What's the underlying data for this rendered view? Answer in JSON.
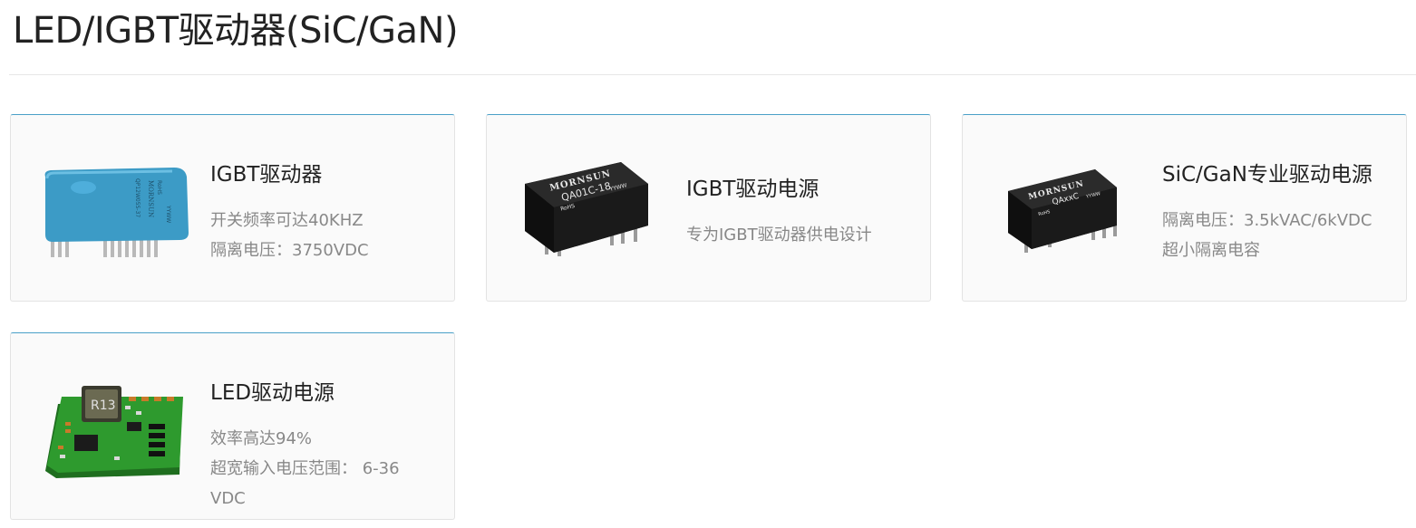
{
  "page": {
    "title": "LED/IGBT驱动器(SiC/GaN)"
  },
  "products": [
    {
      "name": "IGBT驱动器",
      "features": [
        "开关频率可达40KHZ",
        "隔离电压：3750VDC"
      ],
      "image": {
        "kind": "blue-module",
        "brand": "MORNSUN",
        "marks": [
          "QP12W05S-37",
          "RoHS",
          "YYWW"
        ],
        "color": "#3c9bc6"
      }
    },
    {
      "name": "IGBT驱动电源",
      "features": [
        "专为IGBT驱动器供电设计"
      ],
      "image": {
        "kind": "black-module",
        "brand": "MORNSUN",
        "marks": [
          "QA01C-18",
          "RoHS",
          "YYWW"
        ],
        "color": "#1e1e1e"
      }
    },
    {
      "name": "SiC/GaN专业驱动电源",
      "features": [
        "隔离电压：3.5kVAC/6kVDC",
        "超小隔离电容"
      ],
      "image": {
        "kind": "black-module",
        "brand": "MORNSUN",
        "marks": [
          "QAxxC",
          "RoHS",
          "YYWW"
        ],
        "color": "#1e1e1e"
      }
    },
    {
      "name": "LED驱动电源",
      "features": [
        "效率高达94%",
        "超宽输入电压范围： 6-36",
        "VDC"
      ],
      "image": {
        "kind": "green-pcb",
        "marks": [
          "R13"
        ],
        "color": "#2e9a2e"
      }
    }
  ]
}
